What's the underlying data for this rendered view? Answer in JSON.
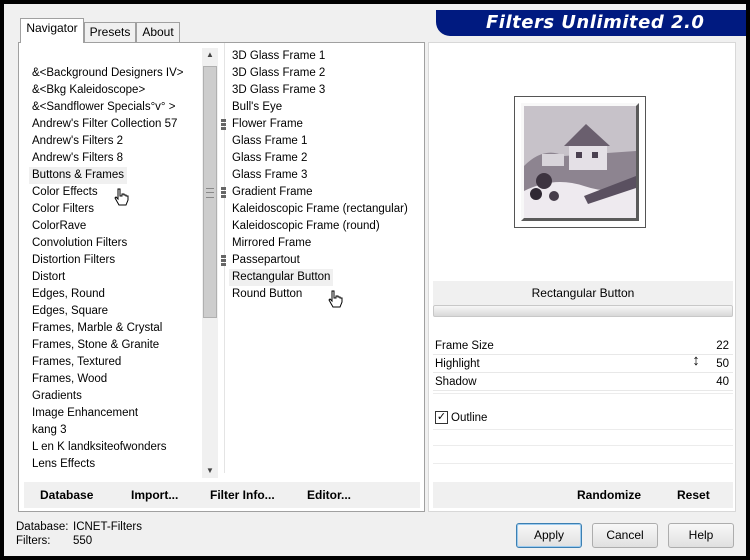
{
  "banner": {
    "title": "Filters Unlimited 2.0"
  },
  "tabs": [
    {
      "label": "Navigator",
      "active": true
    },
    {
      "label": "Presets",
      "active": false
    },
    {
      "label": "About",
      "active": false
    }
  ],
  "categories": {
    "selected": "Buttons & Frames",
    "items": [
      "&<Background Designers IV>",
      "&<Bkg Kaleidoscope>",
      "&<Sandflower Specials°v° >",
      "Andrew's Filter Collection 57",
      "Andrew's Filters 2",
      "Andrew's Filters 8",
      "Buttons & Frames",
      "Color Effects",
      "Color Filters",
      "ColorRave",
      "Convolution Filters",
      "Distortion Filters",
      "Distort",
      "Edges, Round",
      "Edges, Square",
      "Frames, Marble & Crystal",
      "Frames, Stone & Granite",
      "Frames, Textured",
      "Frames, Wood",
      "Gradients",
      "Image Enhancement",
      "kang 3",
      "L en K landksiteofwonders",
      "Lens Effects"
    ]
  },
  "filters": {
    "selected": "Rectangular Button",
    "items": [
      {
        "label": "3D Glass Frame 1",
        "folder": false
      },
      {
        "label": "3D Glass Frame 2",
        "folder": false
      },
      {
        "label": "3D Glass Frame 3",
        "folder": false
      },
      {
        "label": "Bull's Eye",
        "folder": false
      },
      {
        "label": "Flower Frame",
        "folder": true
      },
      {
        "label": "Glass Frame 1",
        "folder": false
      },
      {
        "label": "Glass Frame 2",
        "folder": false
      },
      {
        "label": "Glass Frame 3",
        "folder": false
      },
      {
        "label": "Gradient Frame",
        "folder": true
      },
      {
        "label": "Kaleidoscopic Frame (rectangular)",
        "folder": false
      },
      {
        "label": "Kaleidoscopic Frame (round)",
        "folder": false
      },
      {
        "label": "Mirrored Frame",
        "folder": false
      },
      {
        "label": "Passepartout",
        "folder": true
      },
      {
        "label": "Rectangular Button",
        "folder": false
      },
      {
        "label": "Round Button",
        "folder": false
      }
    ]
  },
  "left_toolbar": {
    "database": "Database",
    "import": "Import...",
    "filter_info": "Filter Info...",
    "editor": "Editor..."
  },
  "preview": {
    "filter_name": "Rectangular Button"
  },
  "params": [
    {
      "name": "Frame Size",
      "value": "22"
    },
    {
      "name": "Highlight",
      "value": "50"
    },
    {
      "name": "Shadow",
      "value": "40"
    }
  ],
  "outline": {
    "label": "Outline",
    "checked": true
  },
  "right_toolbar": {
    "randomize": "Randomize",
    "reset": "Reset"
  },
  "footer": {
    "database_label": "Database:",
    "database_value": "ICNET-Filters",
    "filters_label": "Filters:",
    "filters_value": "550"
  },
  "buttons": {
    "apply": "Apply",
    "cancel": "Cancel",
    "help": "Help"
  }
}
